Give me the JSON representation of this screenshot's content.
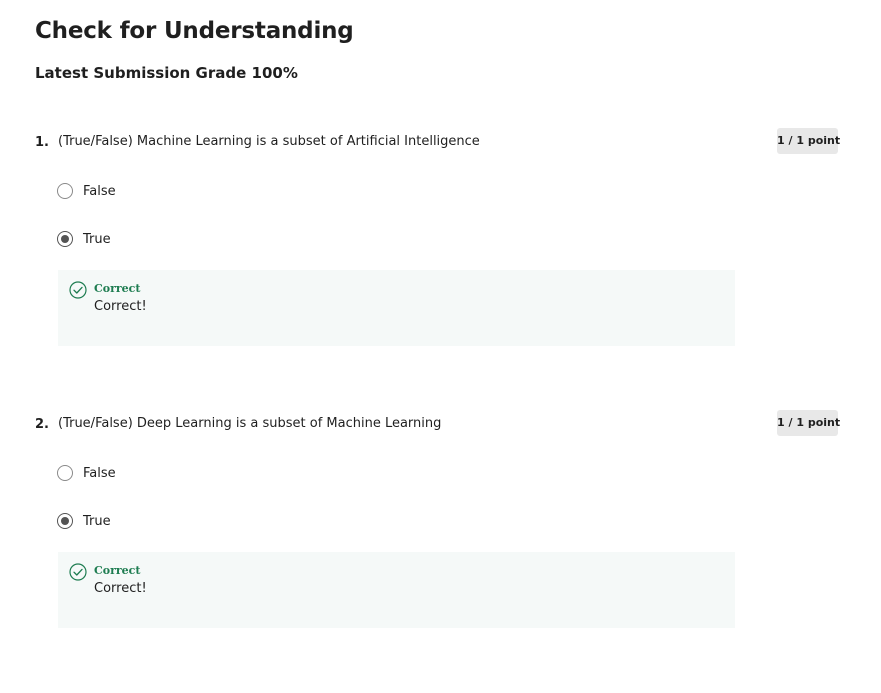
{
  "page": {
    "title": "Check for Understanding",
    "grade_label": "Latest Submission Grade 100%"
  },
  "questions": [
    {
      "number": "1.",
      "text": "(True/False) Machine Learning is a subset of Artificial Intelligence",
      "points": "1 / 1 point",
      "options": [
        {
          "label": "False",
          "selected": false
        },
        {
          "label": "True",
          "selected": true
        }
      ],
      "feedback": {
        "title": "Correct",
        "text": "Correct!",
        "icon": "check-circle-icon",
        "color": "#1d7c50"
      }
    },
    {
      "number": "2.",
      "text": "(True/False) Deep Learning is a subset of Machine Learning",
      "points": "1 / 1 point",
      "options": [
        {
          "label": "False",
          "selected": false
        },
        {
          "label": "True",
          "selected": true
        }
      ],
      "feedback": {
        "title": "Correct",
        "text": "Correct!",
        "icon": "check-circle-icon",
        "color": "#1d7c50"
      }
    }
  ]
}
